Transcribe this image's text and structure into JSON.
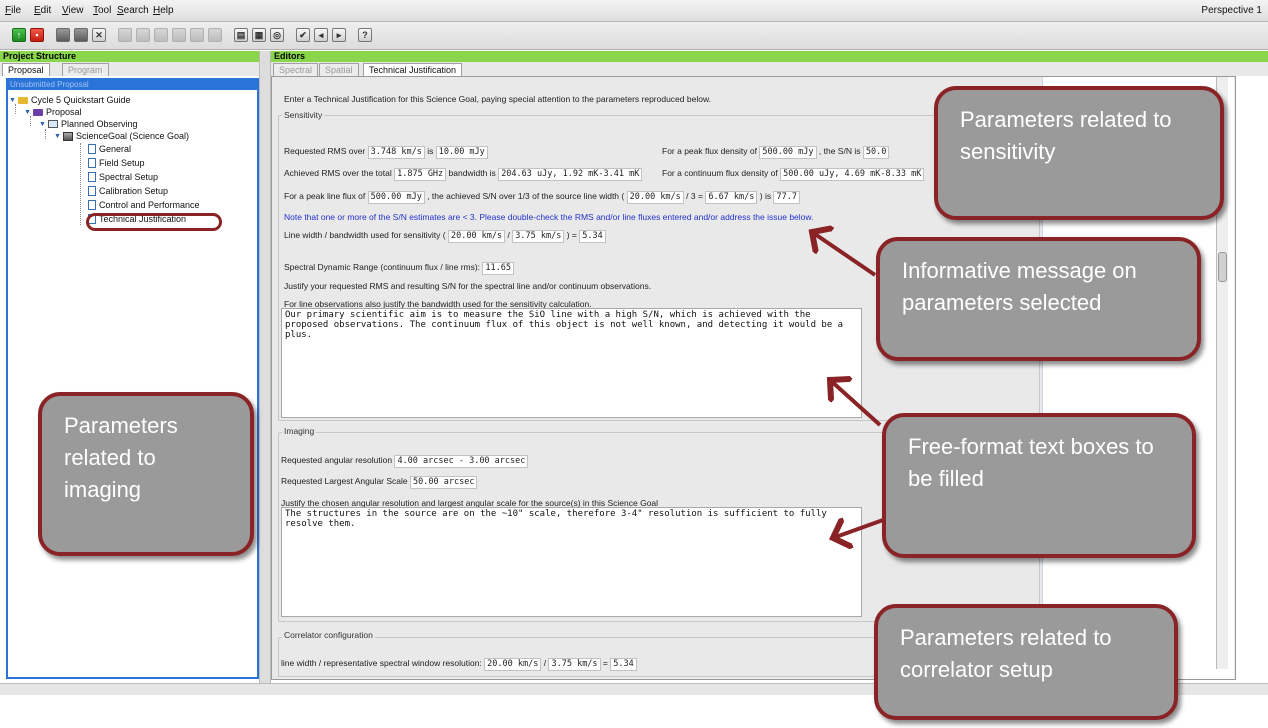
{
  "menubar": {
    "items": [
      "File",
      "Edit",
      "View",
      "Tool",
      "Search",
      "Help"
    ],
    "perspective": "Perspective 1"
  },
  "left_panel": {
    "header": "Project Structure",
    "tabs": [
      "Proposal",
      "Program"
    ],
    "tree_header": "Unsubmitted Proposal",
    "tree": [
      "Cycle 5 Quickstart Guide",
      "Proposal",
      "Planned Observing",
      "ScienceGoal (Science Goal)",
      "General",
      "Field Setup",
      "Spectral Setup",
      "Calibration Setup",
      "Control and Performance",
      "Technical Justification"
    ]
  },
  "editor": {
    "header": "Editors",
    "tabs": [
      "Spectral",
      "Spatial",
      "Technical Justification"
    ],
    "intro": "Enter a Technical Justification for this Science Goal, paying special attention to the parameters reproduced below.",
    "sensitivity": {
      "legend": "Sensitivity",
      "rms_prefix": "Requested RMS over",
      "rms_bw": "3.748 km/s",
      "rms_is": "is",
      "rms_val": "10.00 mJy",
      "peak_prefix": "For a peak flux density of",
      "peak_val": "500.00 mJy",
      "peak_sn_label": ", the S/N is",
      "peak_sn": "50.0",
      "ach_prefix": "Achieved RMS over the total",
      "ach_bw": "1.875 GHz",
      "ach_mid": "bandwidth is",
      "ach_val": "204.63 uJy, 1.92 mK-3.41 mK",
      "cont_prefix": "For a continuum flux density of",
      "cont_val": "500.00 uJy, 4.69 mK-8.33 mK",
      "line_prefix": "For a peak line flux of",
      "line_flux": "500.00 mJy",
      "line_mid": ", the achieved S/N over 1/3 of the source line width (",
      "line_width": "20.00 km/s",
      "line_div": "/ 3 =",
      "line_third": "6.67 km/s",
      "line_is": ") is",
      "line_sn": "77.7",
      "warning": "Note that one or more of the S/N estimates are < 3. Please double-check the RMS and/or line fluxes entered and/or address the issue below.",
      "lw_prefix": "Line width / bandwidth used for sensitivity (",
      "lw_a": "20.00 km/s",
      "lw_slash": "/",
      "lw_b": "3.75 km/s",
      "lw_eq": ") =",
      "lw_val": "5.34",
      "sdr_prefix": "Spectral Dynamic Range (continuum flux / line rms):",
      "sdr_val": "11.65",
      "justify1": "Justify your requested RMS and resulting S/N for the spectral line and/or continuum observations.",
      "justify2": "For line observations also justify the bandwidth used for the sensitivity calculation.",
      "textbox": "Our primary scientific aim is to measure the SiO line with a high S/N, which is achieved with the proposed observations. The continuum flux of this object is not well known, and detecting it would be a plus."
    },
    "imaging": {
      "legend": "Imaging",
      "res_prefix": "Requested angular resolution",
      "res_val": "4.00 arcsec - 3.00 arcsec",
      "las_prefix": "Requested Largest Angular Scale",
      "las_val": "50.00 arcsec",
      "justify": "Justify the chosen angular resolution and largest angular scale for the source(s) in this Science Goal",
      "textbox": "The structures in the source are on the ~10\" scale, therefore 3-4\" resolution is sufficient to fully resolve them."
    },
    "correlator": {
      "legend": "Correlator configuration",
      "prefix": "line width / representative spectral window resolution:",
      "a": "20.00 km/s",
      "slash": "/",
      "b": "3.75 km/s",
      "eq": "=",
      "val": "5.34"
    }
  },
  "callouts": {
    "sensitivity": "Parameters related to sensitivity",
    "informative": "Informative message on parameters selected",
    "freeformat": "Free-format text boxes to be filled",
    "imaging": "Parameters related to imaging",
    "correlator": "Parameters related to correlator setup"
  },
  "colors": {
    "header_green": "#8ad64a",
    "selection_blue": "#2a73d8",
    "callout_border": "#8a2325",
    "callout_fill": "#9a9a9a",
    "warning_text": "#2233cc"
  }
}
